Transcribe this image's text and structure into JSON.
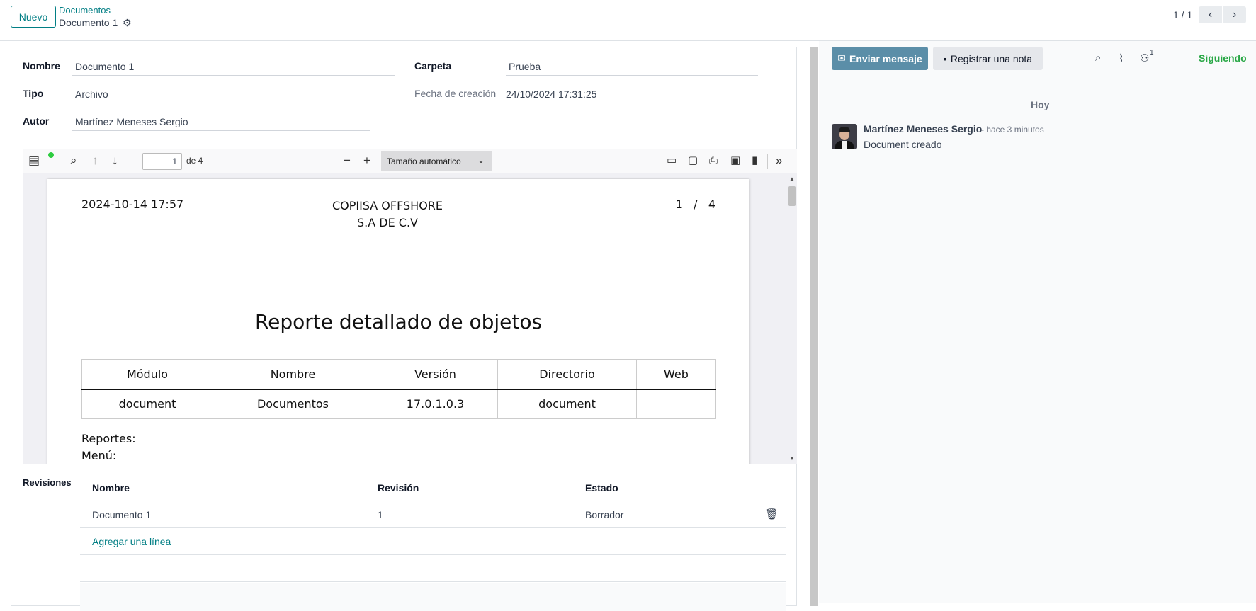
{
  "control_panel": {
    "new_button": "Nuevo",
    "breadcrumb_parent": "Documentos",
    "breadcrumb_current": "Documento 1",
    "pager_value": "1 / 1"
  },
  "form": {
    "nombre_label": "Nombre",
    "nombre_value": "Documento 1",
    "tipo_label": "Tipo",
    "tipo_value": "Archivo",
    "autor_label": "Autor",
    "autor_value": "Martínez Meneses Sergio",
    "carpeta_label": "Carpeta",
    "carpeta_value": "Prueba",
    "fecha_label": "Fecha de creación",
    "fecha_value": "24/10/2024 17:31:25"
  },
  "pdf_viewer": {
    "page_number": "1",
    "page_count_label": "de 4",
    "zoom_label": "Tamaño automático",
    "page": {
      "date": "2024-10-14 17:57",
      "company_line1": "COPIISA OFFSHORE",
      "company_line2": "S.A DE C.V",
      "pager": "1   /   4",
      "title": "Reporte detallado de objetos",
      "table_headers": [
        "Módulo",
        "Nombre",
        "Versión",
        "Directorio",
        "Web"
      ],
      "table_row": [
        "document",
        "Documentos",
        "17.0.1.0.3",
        "document",
        ""
      ],
      "reportes_label": "Reportes:",
      "menu_label": "Menú:"
    }
  },
  "revisions": {
    "section_label": "Revisiones",
    "headers": [
      "Nombre",
      "Revisión",
      "Estado"
    ],
    "rows": [
      {
        "nombre": "Documento 1",
        "revision": "1",
        "estado": "Borrador"
      }
    ],
    "add_line": "Agregar una línea"
  },
  "chatter": {
    "send_message": "Enviar mensaje",
    "log_note": "Registrar una nota",
    "follower_count": "1",
    "following": "Siguiendo",
    "today": "Hoy",
    "message": {
      "author": "Martínez Meneses Sergio",
      "time": "- hace 3 minutos",
      "body": "Document creado"
    }
  },
  "colors": {
    "primary": "#017e84",
    "send_button": "#5b8ea8",
    "following": "#28a745"
  },
  "icons": [
    "gear-icon",
    "chevron-left-icon",
    "chevron-right-icon",
    "sidebar-toggle-icon",
    "search-icon",
    "arrow-up-icon",
    "arrow-down-icon",
    "minus-icon",
    "plus-icon",
    "presentation-icon",
    "open-file-icon",
    "print-icon",
    "download-icon",
    "bookmark-icon",
    "double-chevron-icon",
    "trash-icon",
    "envelope-icon",
    "note-icon",
    "paperclip-icon",
    "user-icon"
  ]
}
